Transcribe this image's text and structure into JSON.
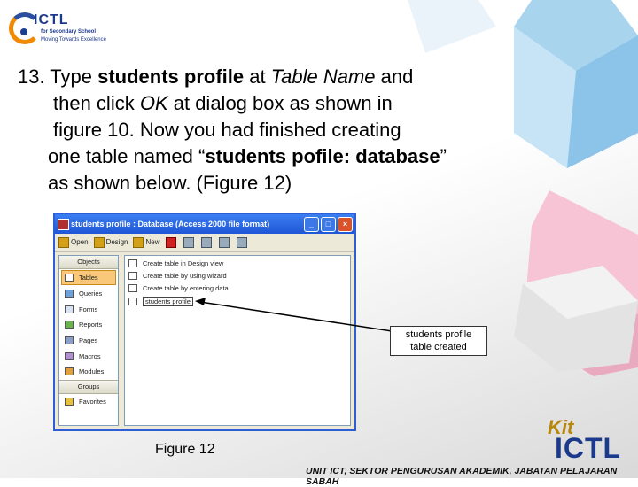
{
  "logo": {
    "name": "ICTL",
    "line1": "for Secondary School",
    "line2": "Moving Towards Excellence"
  },
  "instruction": {
    "lines": [
      [
        {
          "t": "13. Type "
        },
        {
          "t": "students profile",
          "b": true
        },
        {
          "t": " at "
        },
        {
          "t": "Table Name",
          "i": true
        },
        {
          "t": " and"
        }
      ],
      [
        {
          "t": "then click "
        },
        {
          "t": "OK",
          "i": true
        },
        {
          "t": " at dialog box as shown in"
        }
      ],
      [
        {
          "t": "figure 10. Now you had finished creating"
        }
      ],
      [
        {
          "t": "one table named “"
        },
        {
          "t": "students pofile: database",
          "b": true
        },
        {
          "t": "”"
        }
      ],
      [
        {
          "t": "as shown below. (Figure 12)"
        }
      ]
    ]
  },
  "window": {
    "title": "students profile : Database (Access 2000 file format)",
    "toolbar": {
      "open": "Open",
      "design": "Design",
      "new": "New"
    },
    "objects_header": "Objects",
    "objects": [
      "Tables",
      "Queries",
      "Forms",
      "Reports",
      "Pages",
      "Macros",
      "Modules"
    ],
    "groups_header": "Groups",
    "groups": [
      "Favorites"
    ],
    "entries": [
      "Create table in Design view",
      "Create table by using wizard",
      "Create table by entering data",
      "students profile"
    ]
  },
  "callout": {
    "line1": "students profile",
    "line2": "table created"
  },
  "caption": "Figure 12",
  "kit_logo": {
    "kit": "Kit",
    "ictl": "ICTL"
  },
  "footer": "UNIT ICT, SEKTOR PENGURUSAN AKADEMIK, JABATAN PELAJARAN SABAH",
  "colors": {
    "title_blue": "#2d5fd4",
    "accent_orange": "#f08a00",
    "navy": "#1d3a8a"
  }
}
